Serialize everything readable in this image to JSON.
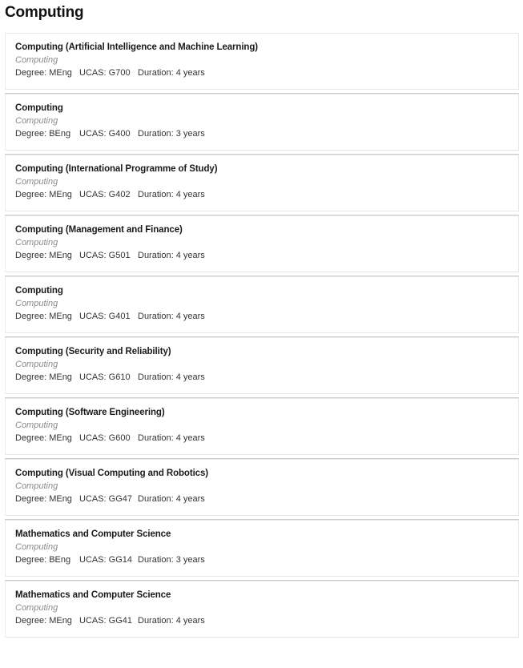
{
  "page": {
    "title": "Computing"
  },
  "courses": [
    {
      "title": "Computing (Artificial Intelligence and Machine Learning)",
      "department": "Computing",
      "degree_label": "Degree: MEng",
      "ucas_label": "UCAS: G700",
      "duration_label": "Duration: 4 years",
      "degree": "MEng",
      "ucas": "G700",
      "duration": "4 years"
    },
    {
      "title": "Computing",
      "department": "Computing",
      "degree_label": "Degree: BEng",
      "ucas_label": "UCAS: G400",
      "duration_label": "Duration: 3 years",
      "degree": "BEng",
      "ucas": "G400",
      "duration": "3 years"
    },
    {
      "title": "Computing (International Programme of Study)",
      "department": "Computing",
      "degree_label": "Degree: MEng",
      "ucas_label": "UCAS: G402",
      "duration_label": "Duration: 4 years",
      "degree": "MEng",
      "ucas": "G402",
      "duration": "4 years"
    },
    {
      "title": "Computing (Management and Finance)",
      "department": "Computing",
      "degree_label": "Degree: MEng",
      "ucas_label": "UCAS: G501",
      "duration_label": "Duration: 4 years",
      "degree": "MEng",
      "ucas": "G501",
      "duration": "4 years"
    },
    {
      "title": "Computing",
      "department": "Computing",
      "degree_label": "Degree: MEng",
      "ucas_label": "UCAS: G401",
      "duration_label": "Duration: 4 years",
      "degree": "MEng",
      "ucas": "G401",
      "duration": "4 years"
    },
    {
      "title": "Computing (Security and Reliability)",
      "department": "Computing",
      "degree_label": "Degree: MEng",
      "ucas_label": "UCAS: G610",
      "duration_label": "Duration: 4 years",
      "degree": "MEng",
      "ucas": "G610",
      "duration": "4 years"
    },
    {
      "title": "Computing (Software Engineering)",
      "department": "Computing",
      "degree_label": "Degree: MEng",
      "ucas_label": "UCAS: G600",
      "duration_label": "Duration: 4 years",
      "degree": "MEng",
      "ucas": "G600",
      "duration": "4 years"
    },
    {
      "title": "Computing (Visual Computing and Robotics)",
      "department": "Computing",
      "degree_label": "Degree: MEng",
      "ucas_label": "UCAS: GG47",
      "duration_label": "Duration: 4 years",
      "degree": "MEng",
      "ucas": "GG47",
      "duration": "4 years"
    },
    {
      "title": "Mathematics and Computer Science",
      "department": "Computing",
      "degree_label": "Degree: BEng",
      "ucas_label": "UCAS: GG14",
      "duration_label": "Duration: 3 years",
      "degree": "BEng",
      "ucas": "GG14",
      "duration": "3 years"
    },
    {
      "title": "Mathematics and Computer Science",
      "department": "Computing",
      "degree_label": "Degree: MEng",
      "ucas_label": "UCAS: GG41",
      "duration_label": "Duration: 4 years",
      "degree": "MEng",
      "ucas": "GG41",
      "duration": "4 years"
    }
  ],
  "colors": {
    "page_background": "#ffffff",
    "card_background": "#ffffff",
    "card_border": "#e6e6ee",
    "separator": "#cfcfcf",
    "title_text": "#1a1a1a",
    "department_text": "#8a8a8a",
    "meta_text": "#333333"
  }
}
